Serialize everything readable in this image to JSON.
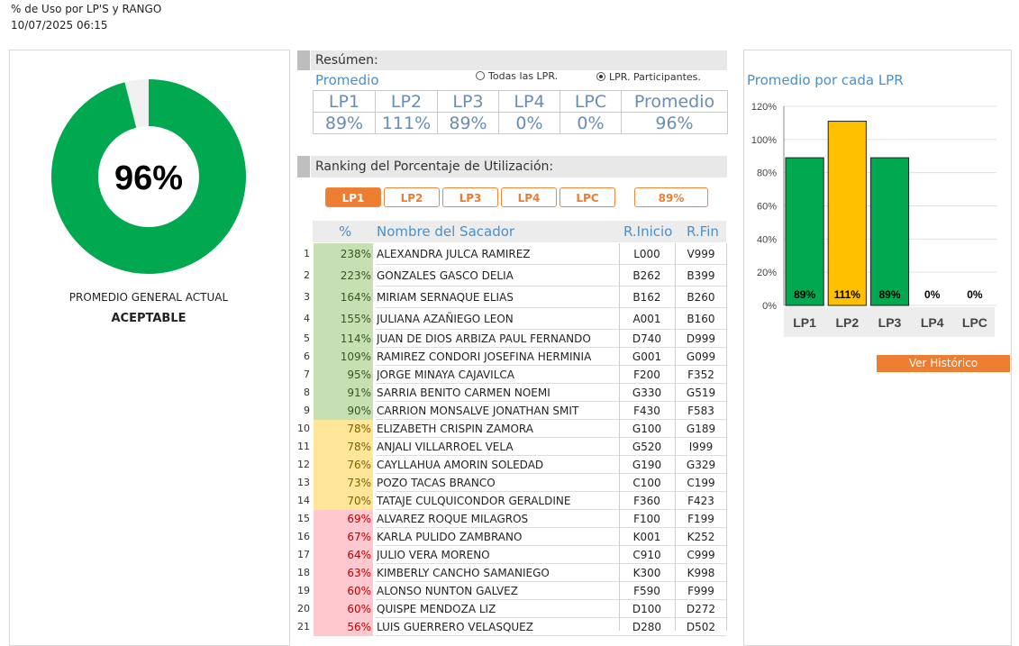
{
  "header": {
    "title": "% de Uso por LP'S y RANGO",
    "datetime": "10/07/2025 06:15"
  },
  "overall": {
    "value_text": "96%",
    "fraction": 0.96,
    "caption": "PROMEDIO GENERAL ACTUAL",
    "status": "ACEPTABLE"
  },
  "summary": {
    "title": "Resúmen:",
    "subtitle": "Promedio",
    "radio_all": "Todas las LPR.",
    "radio_participants": "LPR. Participantes.",
    "headers": [
      "LP1",
      "LP2",
      "LP3",
      "LP4",
      "LPC",
      "Promedio"
    ],
    "values": [
      "89%",
      "111%",
      "89%",
      "0%",
      "0%",
      "96%"
    ]
  },
  "ranking": {
    "title": "Ranking del Porcentaje de Utilización:",
    "tabs": [
      "LP1",
      "LP2",
      "LP3",
      "LP4",
      "LPC"
    ],
    "active_tab": "LP1",
    "avg_value": "89%",
    "columns": {
      "pct": "%",
      "name": "Nombre del Sacador",
      "ini": "R.Inicio",
      "fin": "R.Fin"
    },
    "rows": [
      {
        "n": "1",
        "pct": "238%",
        "name": "ALEXANDRA JULCA RAMIREZ",
        "ini": "L000",
        "fin": "V999",
        "level": "high"
      },
      {
        "n": "2",
        "pct": "223%",
        "name": "GONZALES GASCO DELIA",
        "ini": "B262",
        "fin": "B399",
        "level": "high"
      },
      {
        "n": "3",
        "pct": "164%",
        "name": "MIRIAM SERNAQUE ELIAS",
        "ini": "B162",
        "fin": "B260",
        "level": "high"
      },
      {
        "n": "4",
        "pct": "155%",
        "name": "JULIANA AZAÑIEGO LEON",
        "ini": "A001",
        "fin": "B160",
        "level": "high"
      },
      {
        "n": "5",
        "pct": "114%",
        "name": "JUAN DE DIOS ARBIZA PAUL FERNANDO",
        "ini": "D740",
        "fin": "D999",
        "level": "high"
      },
      {
        "n": "6",
        "pct": "109%",
        "name": "RAMIREZ CONDORI JOSEFINA HERMINIA",
        "ini": "G001",
        "fin": "G099",
        "level": "high"
      },
      {
        "n": "7",
        "pct": "95%",
        "name": "JORGE MINAYA CAJAVILCA",
        "ini": "F200",
        "fin": "F352",
        "level": "high"
      },
      {
        "n": "8",
        "pct": "91%",
        "name": "SARRIA BENITO CARMEN NOEMI",
        "ini": "G330",
        "fin": "G519",
        "level": "high"
      },
      {
        "n": "9",
        "pct": "90%",
        "name": "CARRION MONSALVE JONATHAN SMIT",
        "ini": "F430",
        "fin": "F583",
        "level": "high"
      },
      {
        "n": "10",
        "pct": "78%",
        "name": "ELIZABETH CRISPIN ZAMORA",
        "ini": "G100",
        "fin": "G189",
        "level": "mid"
      },
      {
        "n": "11",
        "pct": "78%",
        "name": "ANJALI VILLARROEL VELA",
        "ini": "G520",
        "fin": "I999",
        "level": "mid"
      },
      {
        "n": "12",
        "pct": "76%",
        "name": "CAYLLAHUA AMORIN SOLEDAD",
        "ini": "G190",
        "fin": "G329",
        "level": "mid"
      },
      {
        "n": "13",
        "pct": "73%",
        "name": "POZO TACAS BRANCO",
        "ini": "C100",
        "fin": "C199",
        "level": "mid"
      },
      {
        "n": "14",
        "pct": "70%",
        "name": "TATAJE CULQUICONDOR GERALDINE",
        "ini": "F360",
        "fin": "F423",
        "level": "mid"
      },
      {
        "n": "15",
        "pct": "69%",
        "name": "ALVAREZ ROQUE MILAGROS",
        "ini": "F100",
        "fin": "F199",
        "level": "low"
      },
      {
        "n": "16",
        "pct": "67%",
        "name": "KARLA PULIDO ZAMBRANO",
        "ini": "K001",
        "fin": "K252",
        "level": "low"
      },
      {
        "n": "17",
        "pct": "64%",
        "name": "JULIO VERA MORENO",
        "ini": "C910",
        "fin": "C999",
        "level": "low"
      },
      {
        "n": "18",
        "pct": "63%",
        "name": "KIMBERLY CANCHO SAMANIEGO",
        "ini": "K300",
        "fin": "K998",
        "level": "low"
      },
      {
        "n": "19",
        "pct": "60%",
        "name": "ALONSO NUNTON GALVEZ",
        "ini": "F590",
        "fin": "F999",
        "level": "low"
      },
      {
        "n": "20",
        "pct": "60%",
        "name": "QUISPE MENDOZA LIZ",
        "ini": "D100",
        "fin": "D272",
        "level": "low"
      },
      {
        "n": "21",
        "pct": "56%",
        "name": "LUIS GUERRERO VELASQUEZ",
        "ini": "D280",
        "fin": "D502",
        "level": "low"
      }
    ]
  },
  "colors": {
    "green": "#00a94f",
    "yellow": "#ffc000",
    "orange": "#ed7d31",
    "blue": "#4a90c8",
    "row_high": "#c6e0b4",
    "row_mid": "#ffe699",
    "row_low": "#ffc7ce",
    "text_high": "#375623",
    "text_mid": "#7f6000",
    "text_low": "#c00000"
  },
  "chart_data": {
    "type": "bar",
    "title": "Promedio por cada LPR",
    "categories": [
      "LP1",
      "LP2",
      "LP3",
      "LP4",
      "LPC"
    ],
    "values": [
      89,
      111,
      89,
      0,
      0
    ],
    "data_labels": [
      "89%",
      "111%",
      "89%",
      "0%",
      "0%"
    ],
    "bar_colors": [
      "#00a94f",
      "#ffc000",
      "#00a94f",
      "#00a94f",
      "#00a94f"
    ],
    "ylim": [
      0,
      120
    ],
    "yticks": [
      "0%",
      "20%",
      "40%",
      "60%",
      "80%",
      "100%",
      "120%"
    ],
    "grid": true
  },
  "history_button": "Ver Histórico"
}
